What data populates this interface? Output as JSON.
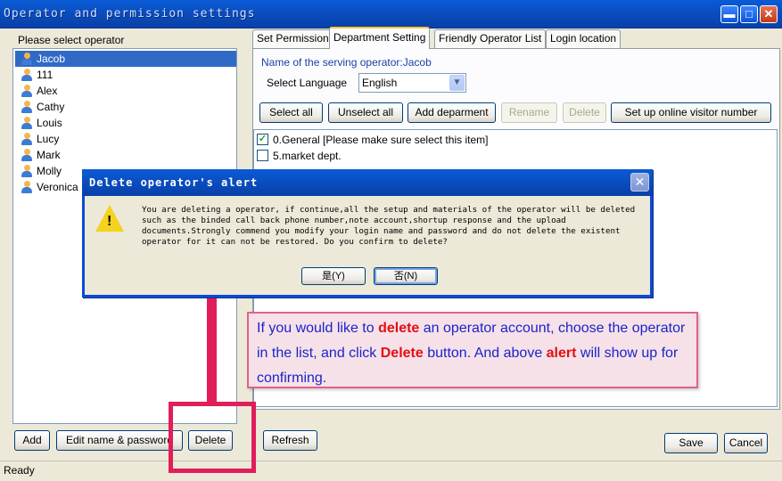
{
  "window": {
    "title": "Operator and permission settings",
    "minimize_symbol": "▬",
    "maximize_symbol": "□",
    "close_symbol": "✕"
  },
  "left_panel": {
    "label": "Please select operator",
    "operators": [
      "Jacob",
      "111",
      "Alex",
      "Cathy",
      "Louis",
      "Lucy",
      "Mark",
      "Molly",
      "Veronica"
    ],
    "selected": "Jacob",
    "buttons": {
      "add": "Add",
      "edit": "Edit name & password",
      "delete": "Delete"
    }
  },
  "tabs": [
    "Set Permission",
    "Department Setting",
    "Friendly Operator List",
    "Login location"
  ],
  "active_tab": "Department Setting",
  "department": {
    "serving_operator": "Name of the serving operator:Jacob",
    "language_label": "Select Language",
    "language_value": "English",
    "buttons": {
      "select_all": "Select all",
      "unselect_all": "Unselect all",
      "add_department": "Add deparment",
      "rename": "Rename",
      "delete": "Delete",
      "setup_visitor": "Set up online visitor number"
    },
    "items": [
      {
        "label": "0.General [Please make sure select this item]",
        "checked": true
      },
      {
        "label": "5.market dept.",
        "checked": false
      }
    ]
  },
  "footer": {
    "refresh": "Refresh",
    "save": "Save",
    "cancel": "Cancel"
  },
  "status": "Ready",
  "alert": {
    "title": "Delete operator's alert",
    "message": "You are deleting a operator, if continue,all the setup and materials of the operator will be deleted such as the binded call back phone number,note account,shortup response and the upload documents.Strongly commend you modify your login name and password and do not delete the existent operator for it can not be restored. Do you confirm to delete?",
    "yes": "是(Y)",
    "no": "否(N)",
    "close_symbol": "✕",
    "warn_symbol": "!"
  },
  "callout": {
    "p1": "If you would like to ",
    "k1": "delete",
    "p2": " an operator account, choose the operator in the list, and click ",
    "k2": "Delete",
    "p3": " button. And above ",
    "k3": "alert",
    "p4": " will show up for confirming."
  },
  "colors": {
    "title_bar": "#0a4ec0",
    "selection": "#316ac5",
    "annotation": "#e11d5a",
    "callout_text": "#1a24c8",
    "callout_keyword": "#e10f14"
  }
}
